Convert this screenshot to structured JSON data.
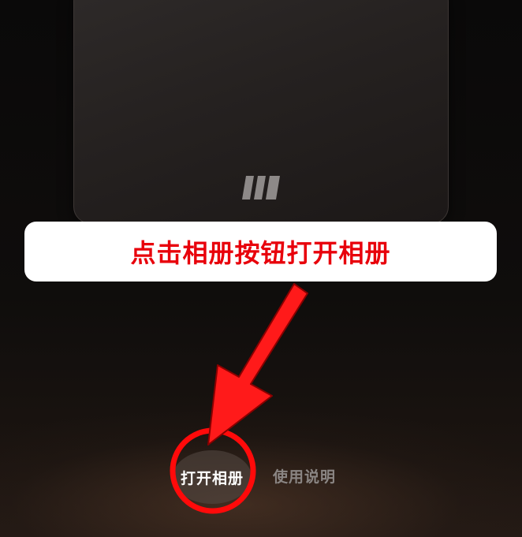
{
  "callout": {
    "text": "点击相册按钮打开相册"
  },
  "bottom_bar": {
    "open_album_label": "打开相册",
    "help_label": "使用说明"
  },
  "colors": {
    "annotation_red": "#e8000b",
    "background": "#0d0b0a",
    "card": "#252120"
  },
  "icons": {
    "card_logo": "brand-logo-icon",
    "annotation_arrow": "red-arrow-icon",
    "annotation_circle": "red-circle-highlight"
  }
}
